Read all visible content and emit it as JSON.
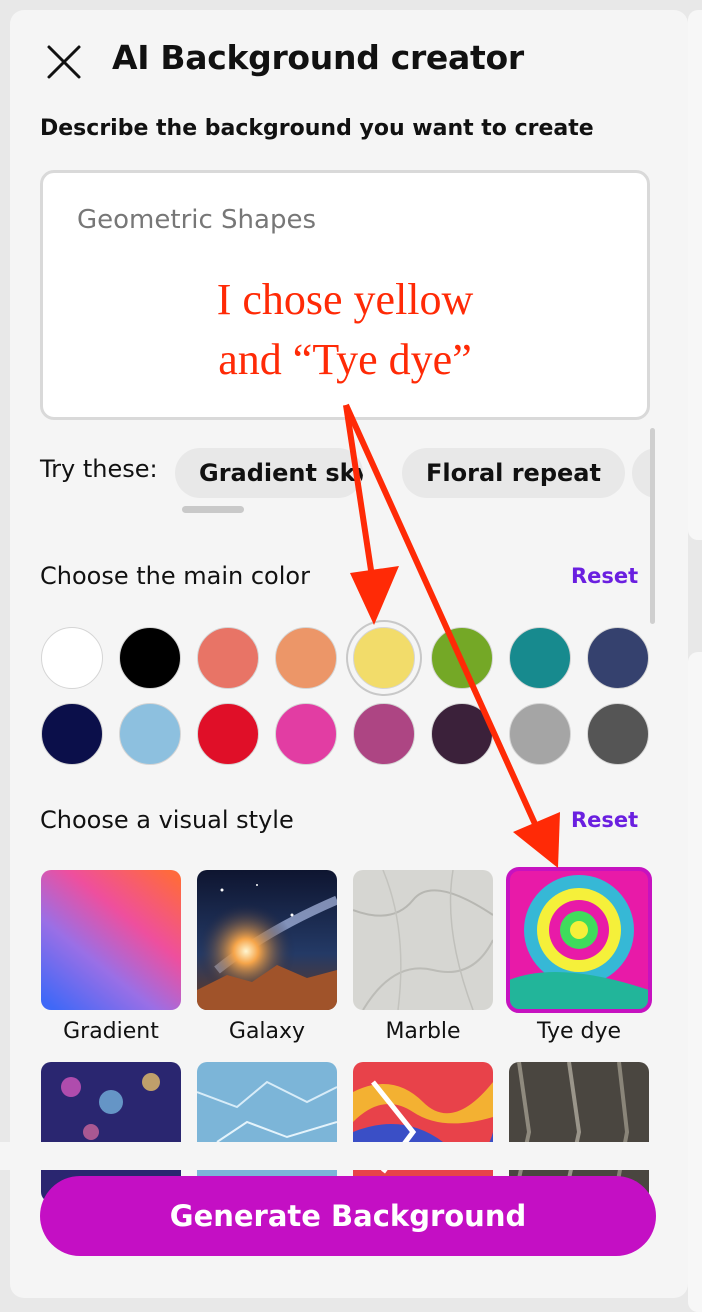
{
  "header": {
    "title": "AI Background creator",
    "close_icon": "close-icon"
  },
  "prompt": {
    "label": "Describe the background you want to create",
    "value": "Geometric Shapes"
  },
  "annotation": {
    "line1": "I chose yellow",
    "line2": "and “Tye dye”",
    "color": "#ff2a06"
  },
  "suggestions": {
    "label": "Try these:",
    "items": [
      "Gradient sky",
      "Floral repeat"
    ]
  },
  "color_section": {
    "label": "Choose the main color",
    "reset_label": "Reset",
    "selected": "#f2dc6a",
    "colors": [
      "#ffffff",
      "#000000",
      "#e87466",
      "#ec9668",
      "#f2dc6a",
      "#74a826",
      "#178a8e",
      "#35416e",
      "#0b0f4a",
      "#8dc0df",
      "#e00f28",
      "#e23da3",
      "#ad4583",
      "#3b213a",
      "#a5a5a5",
      "#555555"
    ]
  },
  "style_section": {
    "label": "Choose a visual style",
    "reset_label": "Reset",
    "selected": "Tye dye",
    "styles": [
      {
        "name": "Gradient"
      },
      {
        "name": "Galaxy"
      },
      {
        "name": "Marble"
      },
      {
        "name": "Tye dye"
      }
    ]
  },
  "generate_button": {
    "label": "Generate Background",
    "color": "#c40fc4"
  },
  "accent_color": "#6a1fe0"
}
